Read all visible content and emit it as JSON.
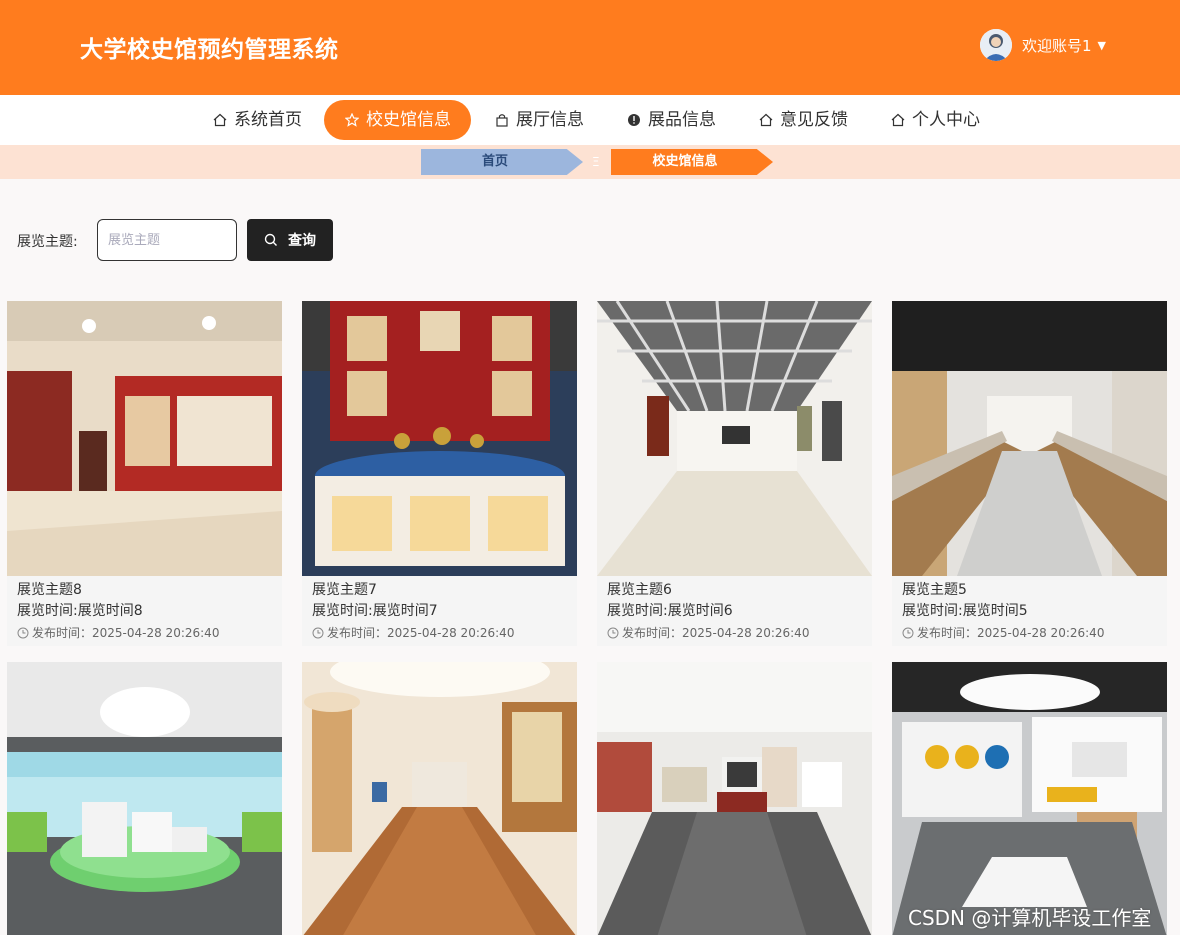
{
  "header": {
    "title": "大学校史馆预约管理系统",
    "greeting": "欢迎账号1",
    "bg_color": "#ff7c1e"
  },
  "nav": {
    "items": [
      {
        "label": "系统首页",
        "icon": "home-icon"
      },
      {
        "label": "校史馆信息",
        "icon": "star-icon",
        "active": true
      },
      {
        "label": "展厅信息",
        "icon": "bag-icon"
      },
      {
        "label": "展品信息",
        "icon": "alert-icon"
      },
      {
        "label": "意见反馈",
        "icon": "home-icon"
      },
      {
        "label": "个人中心",
        "icon": "home-icon"
      }
    ]
  },
  "breadcrumb": {
    "home": "首页",
    "separator": "Ξ",
    "current": "校史馆信息"
  },
  "search": {
    "label": "展览主题:",
    "placeholder": "展览主题",
    "button": "查询"
  },
  "cards": [
    {
      "theme": "展览主题8",
      "time": "展览时间:展览时间8",
      "published": "发布时间：2025-04-28 20:26:40",
      "image": "red-wall-room"
    },
    {
      "theme": "展览主题7",
      "time": "展览时间:展览时间7",
      "published": "发布时间：2025-04-28 20:26:40",
      "image": "round-trophy-cabinet"
    },
    {
      "theme": "展览主题6",
      "time": "展览时间:展览时间6",
      "published": "发布时间：2025-04-28 20:26:40",
      "image": "white-grid-ceiling-hall"
    },
    {
      "theme": "展览主题5",
      "time": "展览时间:展览时间5",
      "published": "发布时间：2025-04-28 20:26:40",
      "image": "display-cases-corridor"
    },
    {
      "image": "green-round-stage"
    },
    {
      "image": "wooden-floor-corridor"
    },
    {
      "image": "dark-floor-exhibit"
    },
    {
      "image": "modern-exhibit-room"
    }
  ],
  "watermark": "CSDN @计算机毕设工作室"
}
